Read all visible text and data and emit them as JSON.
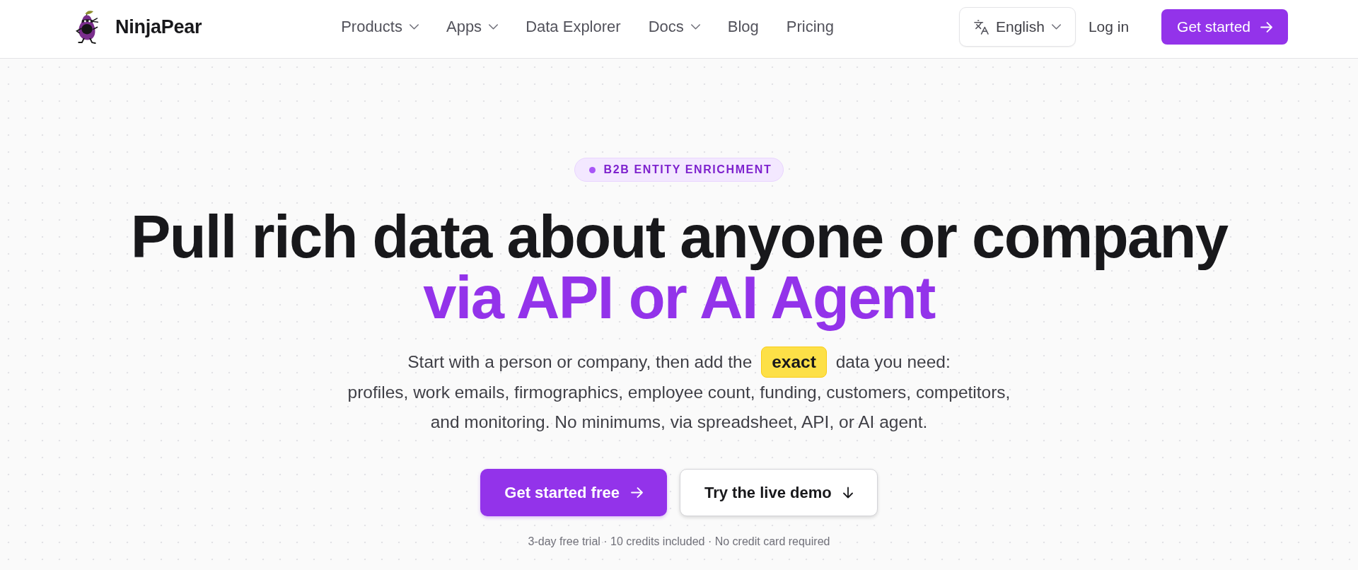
{
  "header": {
    "brand": "NinjaPear",
    "nav": [
      {
        "label": "Products",
        "kind": "menu"
      },
      {
        "label": "Apps",
        "kind": "menu"
      },
      {
        "label": "Data Explorer",
        "kind": "link"
      },
      {
        "label": "Docs",
        "kind": "menu"
      },
      {
        "label": "Blog",
        "kind": "link"
      },
      {
        "label": "Pricing",
        "kind": "link"
      }
    ],
    "language": {
      "label": "English"
    },
    "login": "Log in",
    "cta": "Get started"
  },
  "hero": {
    "badge": "B2B ENTITY ENRICHMENT",
    "headline": "Pull rich data about anyone or company",
    "headline_accent": "via API or AI Agent",
    "description": [
      "Start with a person or company, then add the **exact** data you need:",
      "profiles, work emails, firmographics, employee count, funding, customers, competitors,",
      "and monitoring. No minimums, via spreadsheet, API, or AI agent."
    ],
    "buttons": [
      {
        "label": "Get started free",
        "kind": "primary"
      },
      {
        "label": "Try the live demo",
        "kind": "secondary"
      }
    ],
    "footnote": "3-day free trial · 10 credits included · No credit card required"
  }
}
